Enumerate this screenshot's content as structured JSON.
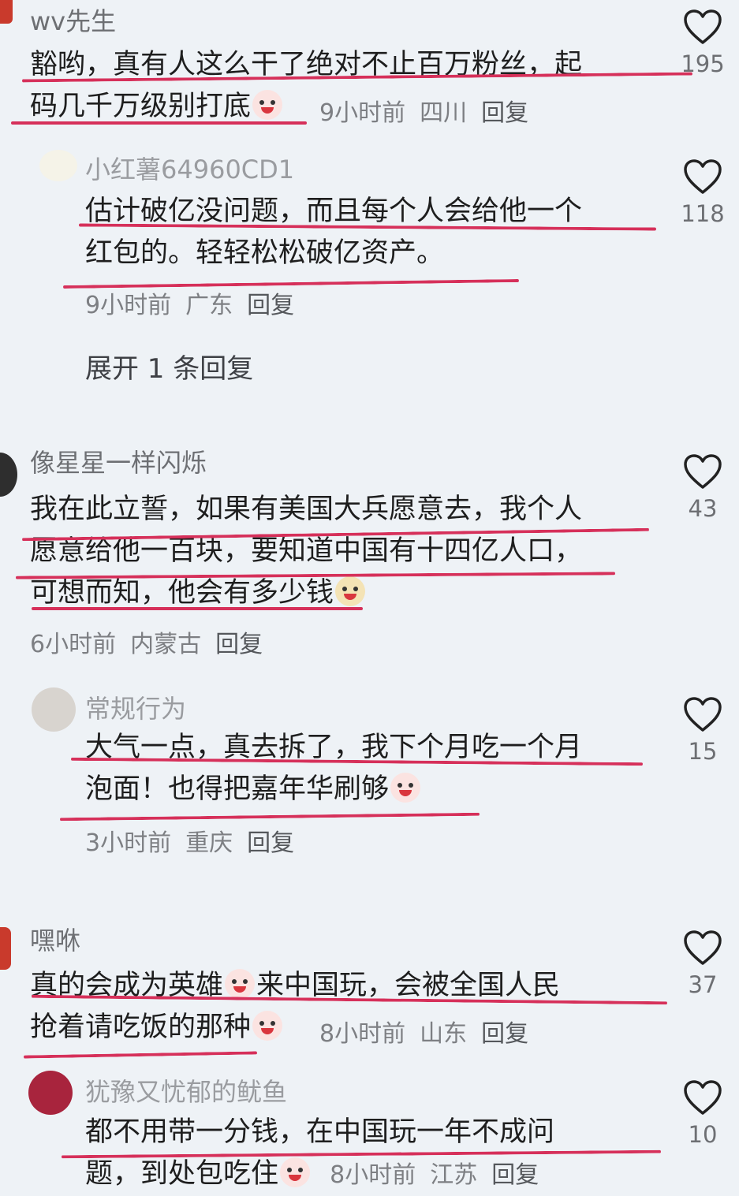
{
  "comments": [
    {
      "username": "wv先生",
      "text_line1": "豁哟，真有人这么干了绝对不止百万粉丝，起",
      "text_line2": "码几千万级别打底",
      "time": "9小时前",
      "location": "四川",
      "reply": "回复",
      "likes": "195"
    },
    {
      "username": "小红薯64960CD1",
      "text_line1": "估计破亿没问题，而且每个人会给他一个",
      "text_line2": "红包的。轻轻松松破亿资产。",
      "time": "9小时前",
      "location": "广东",
      "reply": "回复",
      "likes": "118"
    },
    {
      "expand": "展开 1 条回复"
    },
    {
      "username": "像星星一样闪烁",
      "text_line1": "我在此立誓，如果有美国大兵愿意去，我个人",
      "text_line2": "愿意给他一百块，要知道中国有十四亿人口，",
      "text_line3": "可想而知，他会有多少钱",
      "time": "6小时前",
      "location": "内蒙古",
      "reply": "回复",
      "likes": "43"
    },
    {
      "username": "常规行为",
      "text_line1": "大气一点，真去拆了，我下个月吃一个月",
      "text_line2": "泡面！也得把嘉年华刷够",
      "time": "3小时前",
      "location": "重庆",
      "reply": "回复",
      "likes": "15"
    },
    {
      "username": "嘿咻",
      "text_line1a": "真的会成为英雄",
      "text_line1b": "来中国玩，会被全国人民",
      "text_line2": "抢着请吃饭的那种",
      "time": "8小时前",
      "location": "山东",
      "reply": "回复",
      "likes": "37"
    },
    {
      "username": "犹豫又忧郁的鱿鱼",
      "text_line1": "都不用带一分钱，在中国玩一年不成问",
      "text_line2": "题，到处包吃住",
      "time": "8小时前",
      "location": "江苏",
      "reply": "回复",
      "likes": "10"
    }
  ],
  "colors": {
    "background": "#eef2f6",
    "annotation_line": "#d6305a"
  },
  "icons": {
    "like": "heart-outline-icon",
    "emoji": "laughing-crying-emoji-icon"
  }
}
